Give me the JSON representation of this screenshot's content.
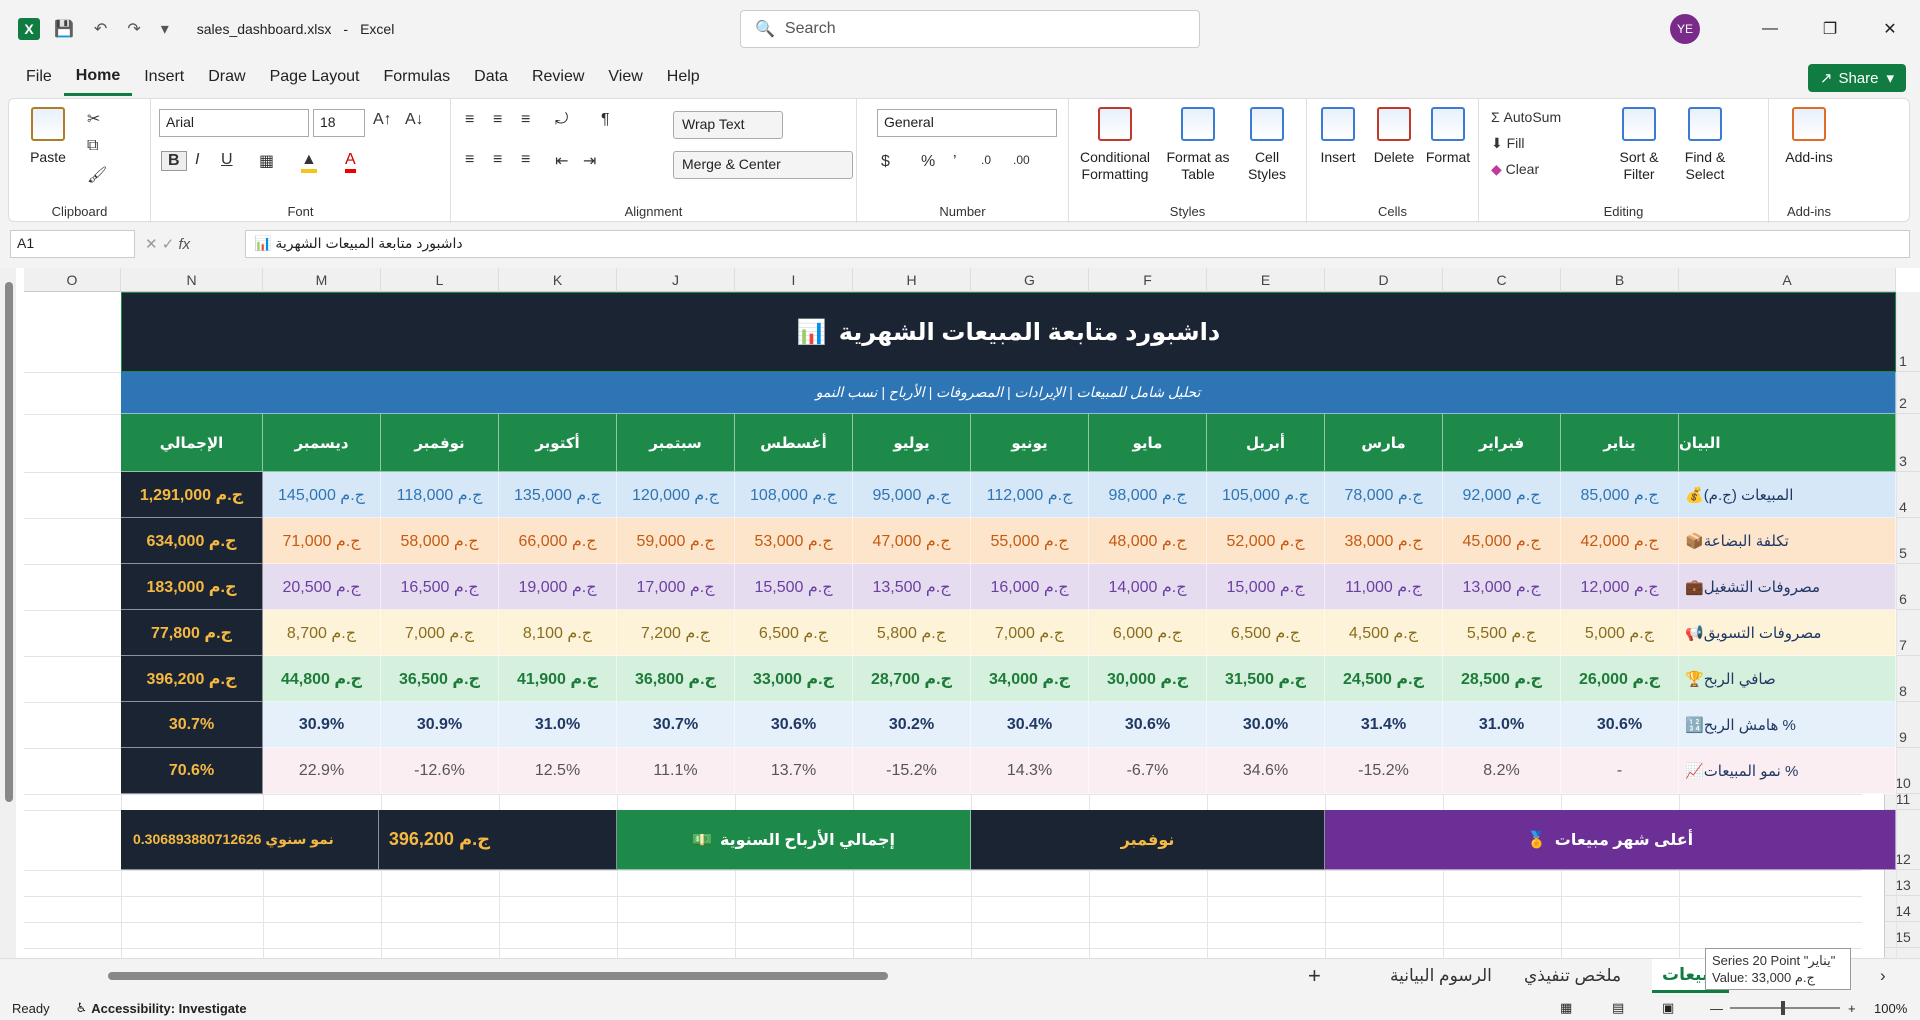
{
  "app": {
    "filename": "sales_dashboard.xlsx",
    "appname": "Excel",
    "avatar": "YE",
    "search_placeholder": "Search"
  },
  "menu": [
    "File",
    "Home",
    "Insert",
    "Draw",
    "Page Layout",
    "Formulas",
    "Data",
    "Review",
    "View",
    "Help"
  ],
  "share_label": "Share",
  "ribbon": {
    "clipboard": {
      "paste": "Paste",
      "label": "Clipboard"
    },
    "font": {
      "name": "Arial",
      "size": "18",
      "label": "Font"
    },
    "alignment": {
      "wrap": "Wrap Text",
      "merge": "Merge & Center",
      "label": "Alignment"
    },
    "number": {
      "format": "General",
      "label": "Number"
    },
    "styles": {
      "cond": [
        "Conditional",
        "Formatting"
      ],
      "table": [
        "Format as",
        "Table"
      ],
      "cell": [
        "Cell",
        "Styles"
      ],
      "label": "Styles"
    },
    "cells": {
      "insert": "Insert",
      "delete": "Delete",
      "format": "Format",
      "label": "Cells"
    },
    "editing": {
      "autosum": "AutoSum",
      "fill": "Fill",
      "clear": "Clear",
      "sort": [
        "Sort &",
        "Filter"
      ],
      "find": [
        "Find &",
        "Select"
      ],
      "label": "Editing"
    },
    "addins": {
      "label": "Add-ins",
      "btn": "Add-ins"
    }
  },
  "formula": {
    "namebox": "A1",
    "fx": "fx",
    "content": "داشبورد متابعة المبيعات الشهرية"
  },
  "columns": [
    "O",
    "N",
    "M",
    "L",
    "K",
    "J",
    "I",
    "H",
    "G",
    "F",
    "E",
    "D",
    "C",
    "B",
    "A"
  ],
  "rows": [
    "1",
    "2",
    "3",
    "4",
    "5",
    "6",
    "7",
    "8",
    "9",
    "10",
    "11",
    "12",
    "13",
    "14",
    "15"
  ],
  "sheet": {
    "title": "داشبورد متابعة المبيعات الشهرية",
    "subtitle": "تحليل شامل للمبيعات | الإيرادات | المصروفات | الأرباح | نسب النمو",
    "header": [
      "البيان",
      "يناير",
      "فبراير",
      "مارس",
      "أبريل",
      "مايو",
      "يونيو",
      "يوليو",
      "أغسطس",
      "سبتمبر",
      "أكتوبر",
      "نوفمبر",
      "ديسمبر",
      "الإجمالي"
    ],
    "data": [
      {
        "label": "المبيعات (ج.م)",
        "values": [
          "ج.م 85,000",
          "ج.م 92,000",
          "ج.م 78,000",
          "ج.م 105,000",
          "ج.م 98,000",
          "ج.م 112,000",
          "ج.م 95,000",
          "ج.م 108,000",
          "ج.م 120,000",
          "ج.م 135,000",
          "ج.م 118,000",
          "ج.م 145,000"
        ],
        "total": "ج.م 1,291,000",
        "bg": "#d6e8f7",
        "color": "#2e74b5",
        "bold": false
      },
      {
        "label": "تكلفة البضاعة",
        "values": [
          "ج.م 42,000",
          "ج.م 45,000",
          "ج.م 38,000",
          "ج.م 52,000",
          "ج.م 48,000",
          "ج.م 55,000",
          "ج.م 47,000",
          "ج.م 53,000",
          "ج.م 59,000",
          "ج.م 66,000",
          "ج.م 58,000",
          "ج.م 71,000"
        ],
        "total": "ج.م 634,000",
        "bg": "#fde5cc",
        "color": "#c55a11",
        "bold": false
      },
      {
        "label": "مصروفات التشغيل",
        "values": [
          "ج.م 12,000",
          "ج.م 13,000",
          "ج.م 11,000",
          "ج.م 15,000",
          "ج.م 14,000",
          "ج.م 16,000",
          "ج.م 13,500",
          "ج.م 15,500",
          "ج.م 17,000",
          "ج.م 19,000",
          "ج.م 16,500",
          "ج.م 20,500"
        ],
        "total": "ج.م 183,000",
        "bg": "#e6dcf0",
        "color": "#6b3fa0",
        "bold": false
      },
      {
        "label": "مصروفات التسويق",
        "values": [
          "ج.م 5,000",
          "ج.م 5,500",
          "ج.م 4,500",
          "ج.م 6,500",
          "ج.م 6,000",
          "ج.م 7,000",
          "ج.م 5,800",
          "ج.م 6,500",
          "ج.م 7,200",
          "ج.م 8,100",
          "ج.م 7,000",
          "ج.م 8,700"
        ],
        "total": "ج.م 77,800",
        "bg": "#fdf3d9",
        "color": "#8a6d1b",
        "bold": false
      },
      {
        "label": "صافي الربح",
        "values": [
          "ج.م 26,000",
          "ج.م 28,500",
          "ج.م 24,500",
          "ج.م 31,500",
          "ج.م 30,000",
          "ج.م 34,000",
          "ج.م 28,700",
          "ج.م 33,000",
          "ج.م 36,800",
          "ج.م 41,900",
          "ج.م 36,500",
          "ج.م 44,800"
        ],
        "total": "ج.م 396,200",
        "bg": "#d5f0dc",
        "color": "#1e7b3a",
        "bold": true
      },
      {
        "label": "% هامش الربح",
        "values": [
          "30.6%",
          "31.0%",
          "31.4%",
          "30.0%",
          "30.6%",
          "30.4%",
          "30.2%",
          "30.6%",
          "30.7%",
          "31.0%",
          "30.9%",
          "30.9%"
        ],
        "total": "30.7%",
        "bg": "#e6f0fa",
        "color": "#1f3864",
        "bold": true
      },
      {
        "label": "% نمو المبيعات",
        "values": [
          "-",
          "8.2%",
          "-15.2%",
          "34.6%",
          "-6.7%",
          "14.3%",
          "-15.2%",
          "13.7%",
          "11.1%",
          "12.5%",
          "-12.6%",
          "22.9%"
        ],
        "total": "70.6%",
        "bg": "#fbeef2",
        "color": "#555555",
        "bold": false
      }
    ],
    "kpis": {
      "top_month_label": "أعلى شهر مبيعات",
      "top_month_value": "نوفمبر",
      "profit_label": "إجمالي الأرباح السنوية",
      "profit_value": "ج.م 396,200",
      "growth": "نمو سنوي 0.306893880712626"
    }
  },
  "tabs": [
    "الرسوم البيانية",
    "ملخص تنفيذي",
    "مبيعات"
  ],
  "tooltip": {
    "line1": "Series 20 Point \"يناير\"",
    "line2": "Value: 33,000 ج.م"
  },
  "status": {
    "ready": "Ready",
    "accessibility": "Accessibility: Investigate",
    "zoom": "100%"
  },
  "colors": {
    "dark": "#1b2433",
    "blue": "#2e75b6",
    "green": "#1e8a4a",
    "purple": "#6b2f96",
    "gold": "#f5b942"
  }
}
